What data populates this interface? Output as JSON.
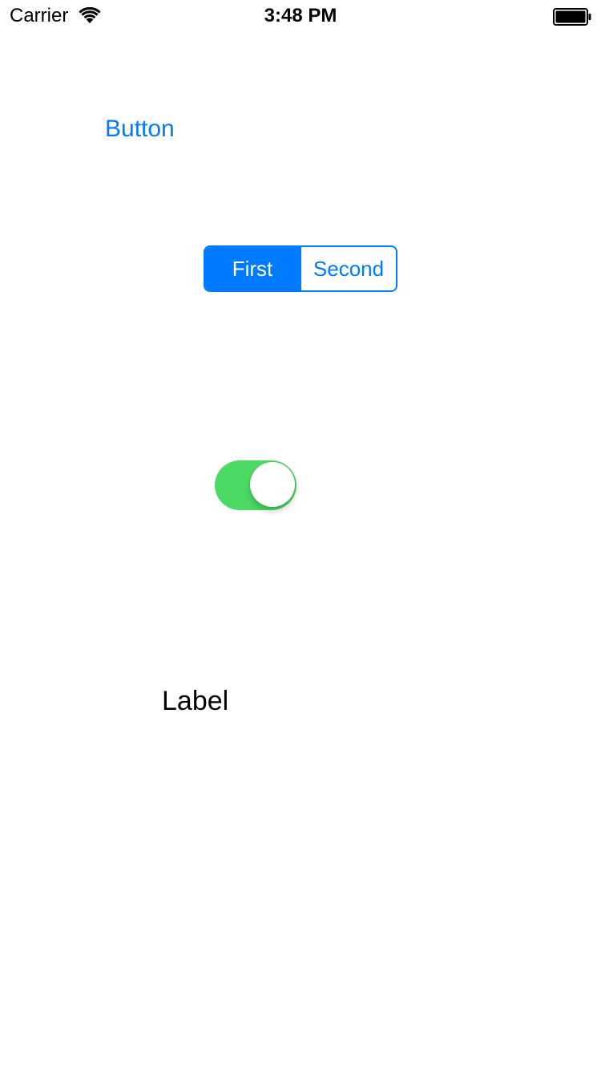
{
  "status_bar": {
    "carrier": "Carrier",
    "time": "3:48 PM",
    "wifi_icon": "wifi-icon",
    "battery_icon": "battery-icon",
    "battery_level": 1.0
  },
  "main": {
    "button_label": "Button",
    "segmented_control": {
      "segments": [
        "First",
        "Second"
      ],
      "selected_index": 0
    },
    "switch": {
      "on": true
    },
    "label_text": "Label"
  },
  "colors": {
    "tint": "#007aff",
    "switch_on": "#4cd964",
    "background": "#ffffff",
    "text": "#000000"
  }
}
